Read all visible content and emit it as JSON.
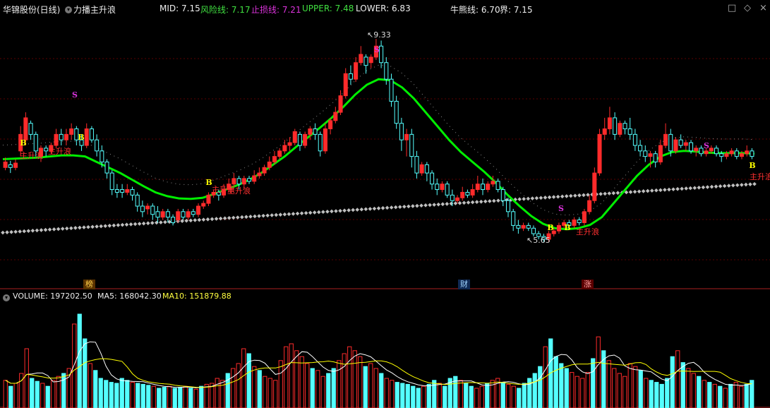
{
  "header": {
    "stock": "华锦股份(日线)",
    "indicator": "力播主升浪",
    "mid_label": "MID: ",
    "mid_value": "7.15",
    "risk_label": "风险线: ",
    "risk_value": "7.17",
    "stop_label": "止损线: ",
    "stop_value": "7.21",
    "upper_label": "UPPER: ",
    "upper_value": "7.48",
    "lower_label": "LOWER: ",
    "lower_value": "6.83",
    "bull_label": "牛熊线: ",
    "bull_value": "6.70",
    "jie_label": "界: ",
    "jie_value": "7.15"
  },
  "window_buttons": [
    "□",
    "◇",
    "×"
  ],
  "volume_header": {
    "vol_label": "VOLUME: ",
    "vol_value": "197202.50",
    "ma5_label": "MA5: ",
    "ma5_value": "168042.30",
    "ma10_label": "MA10: ",
    "ma10_value": "151879.88"
  },
  "event_tags": [
    "榜",
    "财",
    "涨"
  ],
  "colors": {
    "up": "#ff2b2b",
    "down": "#54ffff",
    "green": "#00ee00",
    "yellow": "#ffff00",
    "magenta": "#dd33dd",
    "grey": "#bfbfbf"
  },
  "chart_data": {
    "type": "candlestick",
    "y_range": [
      5.2,
      9.6
    ],
    "price_labels": {
      "high": "9.33",
      "low": "5.65"
    },
    "high_value": 9.33,
    "low_value": 5.65,
    "signals": [
      "B",
      "S",
      "主升浪"
    ],
    "candles": [
      [
        7.0,
        7.1,
        7.18,
        6.95
      ],
      [
        7.05,
        7.0,
        7.12,
        6.9
      ],
      [
        7.0,
        7.08,
        7.15,
        6.95
      ],
      [
        7.3,
        7.6,
        7.75,
        7.2
      ],
      [
        7.5,
        7.9,
        8.0,
        7.4
      ],
      [
        7.8,
        7.6,
        7.85,
        7.5
      ],
      [
        7.6,
        7.3,
        7.65,
        7.2
      ],
      [
        7.2,
        7.35,
        7.4,
        7.1
      ],
      [
        7.35,
        7.3,
        7.4,
        7.2
      ],
      [
        7.3,
        7.4,
        7.45,
        7.25
      ],
      [
        7.4,
        7.6,
        7.7,
        7.35
      ],
      [
        7.6,
        7.5,
        7.7,
        7.4
      ],
      [
        7.5,
        7.6,
        7.7,
        7.4
      ],
      [
        7.6,
        7.7,
        7.8,
        7.5
      ],
      [
        7.7,
        7.5,
        7.75,
        7.4
      ],
      [
        7.5,
        7.4,
        7.6,
        7.3
      ],
      [
        7.4,
        7.7,
        7.8,
        7.35
      ],
      [
        7.7,
        7.5,
        7.75,
        7.45
      ],
      [
        7.5,
        7.3,
        7.6,
        7.2
      ],
      [
        7.3,
        7.1,
        7.4,
        7.0
      ],
      [
        7.1,
        6.9,
        7.15,
        6.8
      ],
      [
        6.9,
        6.6,
        6.95,
        6.5
      ],
      [
        6.6,
        6.55,
        6.7,
        6.45
      ],
      [
        6.6,
        6.55,
        6.7,
        6.45
      ],
      [
        6.55,
        6.6,
        6.7,
        6.5
      ],
      [
        6.6,
        6.5,
        6.65,
        6.4
      ],
      [
        6.5,
        6.3,
        6.55,
        6.2
      ],
      [
        6.3,
        6.2,
        6.4,
        6.1
      ],
      [
        6.25,
        6.3,
        6.35,
        6.15
      ],
      [
        6.3,
        6.15,
        6.35,
        6.05
      ],
      [
        6.2,
        6.1,
        6.3,
        6.0
      ],
      [
        6.1,
        6.2,
        6.25,
        6.05
      ],
      [
        6.2,
        6.1,
        6.25,
        6.0
      ],
      [
        6.1,
        6.0,
        6.15,
        5.95
      ],
      [
        6.05,
        6.2,
        6.25,
        6.0
      ],
      [
        6.2,
        6.1,
        6.25,
        6.05
      ],
      [
        6.1,
        6.2,
        6.25,
        6.05
      ],
      [
        6.2,
        6.15,
        6.25,
        6.1
      ],
      [
        6.15,
        6.3,
        6.35,
        6.1
      ],
      [
        6.3,
        6.35,
        6.4,
        6.25
      ],
      [
        6.35,
        6.5,
        6.55,
        6.3
      ],
      [
        6.5,
        6.55,
        6.6,
        6.45
      ],
      [
        6.55,
        6.5,
        6.6,
        6.4
      ],
      [
        6.5,
        6.6,
        6.7,
        6.45
      ],
      [
        6.6,
        6.7,
        6.8,
        6.55
      ],
      [
        6.7,
        6.8,
        6.9,
        6.65
      ],
      [
        6.8,
        6.7,
        6.85,
        6.6
      ],
      [
        6.7,
        6.8,
        6.85,
        6.6
      ],
      [
        6.8,
        6.75,
        6.85,
        6.7
      ],
      [
        6.75,
        6.85,
        6.95,
        6.7
      ],
      [
        6.85,
        6.9,
        7.0,
        6.8
      ],
      [
        6.9,
        7.0,
        7.05,
        6.85
      ],
      [
        7.0,
        7.1,
        7.2,
        6.95
      ],
      [
        7.1,
        7.2,
        7.3,
        7.05
      ],
      [
        7.2,
        7.3,
        7.35,
        7.15
      ],
      [
        7.3,
        7.4,
        7.5,
        7.25
      ],
      [
        7.4,
        7.45,
        7.55,
        7.3
      ],
      [
        7.45,
        7.65,
        7.7,
        7.4
      ],
      [
        7.6,
        7.4,
        7.65,
        7.3
      ],
      [
        7.4,
        7.6,
        7.65,
        7.35
      ],
      [
        7.6,
        7.7,
        7.75,
        7.5
      ],
      [
        7.7,
        7.6,
        7.8,
        7.5
      ],
      [
        7.6,
        7.3,
        7.65,
        7.2
      ],
      [
        7.3,
        7.7,
        7.8,
        7.25
      ],
      [
        7.7,
        7.85,
        7.9,
        7.6
      ],
      [
        7.85,
        8.0,
        8.1,
        7.8
      ],
      [
        8.0,
        8.3,
        8.4,
        7.95
      ],
      [
        8.3,
        8.7,
        8.8,
        8.25
      ],
      [
        8.7,
        8.6,
        8.85,
        8.5
      ],
      [
        8.6,
        8.9,
        9.0,
        8.55
      ],
      [
        8.9,
        9.05,
        9.2,
        8.85
      ],
      [
        9.0,
        8.85,
        9.05,
        8.7
      ],
      [
        8.9,
        9.0,
        9.05,
        8.8
      ],
      [
        9.0,
        9.2,
        9.33,
        8.95
      ],
      [
        9.2,
        8.9,
        9.3,
        8.8
      ],
      [
        8.9,
        8.6,
        9.0,
        8.5
      ],
      [
        8.6,
        8.2,
        8.7,
        8.1
      ],
      [
        8.2,
        7.8,
        8.3,
        7.7
      ],
      [
        7.8,
        7.5,
        7.9,
        7.3
      ],
      [
        7.5,
        7.6,
        7.7,
        7.2
      ],
      [
        7.6,
        7.2,
        7.7,
        7.0
      ],
      [
        7.2,
        6.9,
        7.3,
        6.8
      ],
      [
        6.9,
        7.05,
        7.1,
        6.85
      ],
      [
        7.05,
        6.9,
        7.1,
        6.75
      ],
      [
        6.9,
        6.7,
        6.95,
        6.6
      ],
      [
        6.7,
        6.6,
        6.8,
        6.5
      ],
      [
        6.6,
        6.7,
        6.75,
        6.55
      ],
      [
        6.7,
        6.5,
        6.75,
        6.45
      ],
      [
        6.5,
        6.4,
        6.6,
        6.3
      ],
      [
        6.4,
        6.45,
        6.5,
        6.35
      ],
      [
        6.45,
        6.55,
        6.65,
        6.4
      ],
      [
        6.55,
        6.5,
        6.6,
        6.45
      ],
      [
        6.5,
        6.6,
        6.7,
        6.45
      ],
      [
        6.6,
        6.7,
        6.85,
        6.55
      ],
      [
        6.7,
        6.6,
        6.8,
        6.5
      ],
      [
        6.6,
        6.7,
        6.75,
        6.55
      ],
      [
        6.7,
        6.75,
        6.85,
        6.65
      ],
      [
        6.75,
        6.6,
        6.8,
        6.55
      ],
      [
        6.6,
        6.4,
        6.65,
        6.3
      ],
      [
        6.4,
        6.2,
        6.45,
        6.1
      ],
      [
        6.2,
        5.95,
        6.25,
        5.85
      ],
      [
        5.95,
        5.9,
        6.05,
        5.8
      ],
      [
        5.9,
        5.95,
        6.0,
        5.85
      ],
      [
        5.95,
        5.9,
        6.0,
        5.85
      ],
      [
        5.9,
        5.8,
        5.95,
        5.75
      ],
      [
        5.8,
        5.75,
        5.85,
        5.7
      ],
      [
        5.75,
        5.7,
        5.8,
        5.65
      ],
      [
        5.7,
        5.8,
        5.85,
        5.65
      ],
      [
        5.8,
        5.85,
        5.9,
        5.75
      ],
      [
        5.85,
        5.95,
        6.0,
        5.8
      ],
      [
        5.95,
        6.0,
        6.05,
        5.9
      ],
      [
        6.0,
        5.95,
        6.05,
        5.9
      ],
      [
        5.95,
        6.05,
        6.1,
        5.9
      ],
      [
        6.05,
        6.0,
        6.1,
        5.95
      ],
      [
        6.0,
        6.2,
        6.25,
        5.95
      ],
      [
        6.2,
        6.4,
        6.5,
        6.15
      ],
      [
        6.4,
        6.9,
        7.0,
        6.35
      ],
      [
        6.9,
        7.6,
        7.7,
        6.85
      ],
      [
        7.6,
        7.7,
        7.9,
        7.5
      ],
      [
        7.7,
        7.9,
        8.1,
        7.6
      ],
      [
        7.9,
        7.6,
        8.0,
        7.5
      ],
      [
        7.6,
        7.8,
        7.85,
        7.55
      ],
      [
        7.8,
        7.7,
        7.85,
        7.6
      ],
      [
        7.7,
        7.6,
        7.9,
        7.5
      ],
      [
        7.6,
        7.4,
        7.7,
        7.3
      ],
      [
        7.4,
        7.3,
        7.5,
        7.2
      ],
      [
        7.3,
        7.2,
        7.4,
        7.1
      ],
      [
        7.2,
        7.25,
        7.3,
        7.0
      ],
      [
        7.25,
        7.1,
        7.3,
        7.0
      ],
      [
        7.1,
        7.4,
        7.5,
        7.05
      ],
      [
        7.4,
        7.6,
        7.8,
        7.35
      ],
      [
        7.6,
        7.3,
        7.7,
        7.2
      ],
      [
        7.3,
        7.5,
        7.55,
        7.25
      ],
      [
        7.5,
        7.4,
        7.6,
        7.35
      ],
      [
        7.4,
        7.45,
        7.5,
        7.3
      ],
      [
        7.45,
        7.3,
        7.5,
        7.25
      ],
      [
        7.3,
        7.35,
        7.4,
        7.2
      ],
      [
        7.35,
        7.25,
        7.4,
        7.2
      ],
      [
        7.25,
        7.3,
        7.35,
        7.2
      ],
      [
        7.3,
        7.35,
        7.4,
        7.25
      ],
      [
        7.35,
        7.25,
        7.4,
        7.2
      ],
      [
        7.25,
        7.2,
        7.3,
        7.1
      ],
      [
        7.2,
        7.25,
        7.3,
        7.15
      ],
      [
        7.25,
        7.3,
        7.35,
        7.2
      ],
      [
        7.3,
        7.2,
        7.35,
        7.15
      ],
      [
        7.2,
        7.25,
        7.3,
        7.15
      ],
      [
        7.25,
        7.3,
        7.4,
        7.2
      ],
      [
        7.3,
        7.2,
        7.35,
        7.15
      ]
    ],
    "mid_line": [
      7.15,
      7.16,
      7.17,
      7.18,
      7.2,
      7.22,
      7.22,
      7.2,
      7.1,
      7.0,
      6.9,
      6.78,
      6.66,
      6.55,
      6.48,
      6.44,
      6.43,
      6.45,
      6.52,
      6.6,
      6.68,
      6.78,
      6.9,
      7.05,
      7.2,
      7.38,
      7.55,
      7.72,
      7.9,
      8.1,
      8.32,
      8.5,
      8.6,
      8.58,
      8.45,
      8.25,
      8.0,
      7.75,
      7.5,
      7.28,
      7.1,
      6.92,
      6.72,
      6.5,
      6.3,
      6.12,
      5.98,
      5.9,
      5.88,
      5.9,
      5.96,
      6.1,
      6.35,
      6.6,
      6.85,
      7.05,
      7.2,
      7.28,
      7.3,
      7.29,
      7.27,
      7.26,
      7.26,
      7.26,
      7.25
    ],
    "bull_line": [
      5.82,
      5.84,
      5.86,
      5.88,
      5.9,
      5.92,
      5.94,
      5.96,
      5.98,
      6.0,
      6.02,
      6.04,
      6.06,
      6.08,
      6.1,
      6.12,
      6.14,
      6.16,
      6.18,
      6.2,
      6.22,
      6.24,
      6.26,
      6.28,
      6.3,
      6.32,
      6.34,
      6.36,
      6.38,
      6.4,
      6.42,
      6.44,
      6.46,
      6.48,
      6.5,
      6.52,
      6.54,
      6.56,
      6.58,
      6.6,
      6.62,
      6.64,
      6.66,
      6.68,
      6.7
    ],
    "volume": [
      28,
      22,
      25,
      35,
      60,
      30,
      27,
      25,
      22,
      28,
      32,
      35,
      40,
      85,
      95,
      70,
      45,
      38,
      30,
      28,
      26,
      25,
      30,
      28,
      26,
      25,
      24,
      23,
      22,
      20,
      21,
      22,
      20,
      21,
      22,
      20,
      19,
      22,
      24,
      25,
      30,
      28,
      35,
      40,
      45,
      60,
      55,
      42,
      38,
      32,
      30,
      28,
      48,
      62,
      65,
      58,
      52,
      45,
      40,
      38,
      32,
      35,
      40,
      48,
      55,
      62,
      58,
      52,
      42,
      45,
      40,
      35,
      30,
      28,
      26,
      25,
      24,
      22,
      20,
      22,
      24,
      28,
      25,
      22,
      30,
      32,
      28,
      25,
      22,
      20,
      22,
      25,
      28,
      30,
      26,
      24,
      22,
      20,
      25,
      30,
      35,
      42,
      62,
      70,
      52,
      45,
      40,
      36,
      32,
      30,
      36,
      50,
      72,
      58,
      48,
      40,
      35,
      32,
      45,
      42,
      38,
      30,
      28,
      26,
      24,
      30,
      52,
      58,
      46,
      40,
      35,
      32,
      28,
      26,
      24,
      22,
      20,
      24,
      26,
      22,
      24,
      28
    ]
  }
}
